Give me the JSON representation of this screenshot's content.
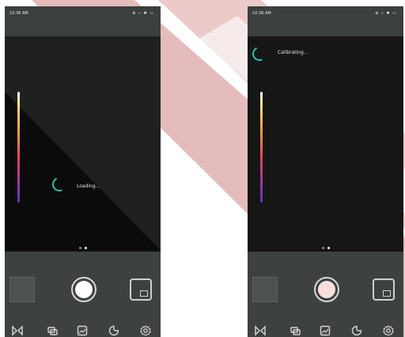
{
  "left_screen": {
    "status_time": "10:36 AM",
    "status_icons": "⊕ ⌁ ✱ ▭",
    "status_message": "Loading...",
    "page_dots": 2,
    "active_dot": 1
  },
  "right_screen": {
    "status_time": "10:36 AM",
    "status_icons": "⊕ ⌁ ✱ ▭",
    "status_message": "Calibrating...",
    "page_dots": 2,
    "active_dot": 1
  },
  "toolbar_icons": [
    "mirror-icon",
    "layers-icon",
    "image-mode-icon",
    "palette-icon",
    "settings-icon"
  ],
  "colors": {
    "accent": "#28c6a5",
    "background_logo": "#a3100e",
    "control_panel": "#3d4240",
    "status_bar": "#3b3f3d"
  }
}
